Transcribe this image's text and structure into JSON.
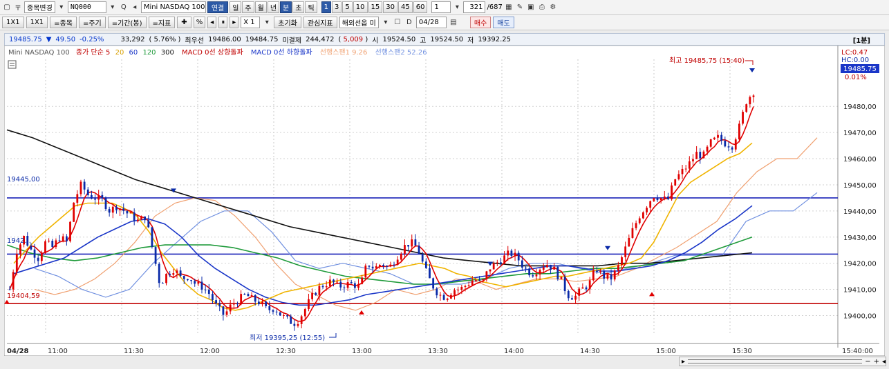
{
  "toolbar": {
    "stock_change_label": "종목변경",
    "code": "NQ000",
    "search_hint": "Q",
    "name": "Mini NASDAQ 100",
    "linked_label": "연결",
    "periods": [
      "일",
      "주",
      "월",
      "년",
      "분",
      "초",
      "틱"
    ],
    "period_selected": "분",
    "intervals": [
      "1",
      "3",
      "5",
      "10",
      "15",
      "30",
      "45",
      "60"
    ],
    "interval_selected": "1",
    "count_value": "1",
    "pages": "321",
    "pages_total": "/687"
  },
  "toolbar2": {
    "ratio1": "1X1",
    "ratio2": "1X1",
    "item_label": "=종목",
    "cycle_label": "=주기",
    "period_label": "=기간(봉)",
    "indicator_label": "=지표",
    "zoom": "X 1",
    "reset_label": "초기화",
    "interest_label": "관심지표",
    "overseas_label": "해외선옵 미",
    "date_value": "04/28",
    "buy_label": "매수",
    "sell_label": "매도"
  },
  "quote": {
    "price": "19485.75",
    "arrow": "▼",
    "change": "49.50",
    "change_pct": "-0.25%",
    "volume": "33,292",
    "volume_pct": "5.76%",
    "best_bid_label": "최우선",
    "bid": "19486.00",
    "ask": "19484.75",
    "unsettled_label": "미결제",
    "open_interest": "244,472",
    "oi_change": "5,009",
    "open_label": "시",
    "open": "19524.50",
    "high_label": "고",
    "high": "19524.50",
    "low_label": "저",
    "low": "19392.25",
    "period_badge": "[1분]"
  },
  "legend": {
    "name": "Mini NASDAQ 100",
    "ma_label": "종가 단순 5",
    "ma_20": "20",
    "ma_60": "60",
    "ma_120": "120",
    "ma_300": "300",
    "macd_up": "MACD 0선 상향돌파",
    "macd_down": "MACD 0선 하향돌파",
    "span1": "선행스팬1 9.26",
    "span2": "선행스팬2 52.26"
  },
  "colors": {
    "up": "#e00000",
    "down": "#0a2aa8",
    "ma5": "#e00000",
    "ma20": "#f0b400",
    "ma60": "#1a36c8",
    "ma120": "#1e9a3a",
    "ma300": "#111111",
    "span1": "#f0a070",
    "span2": "#7090e0",
    "hline_blue": "#1a22b8",
    "hline_red": "#c00000"
  },
  "chart_data": {
    "type": "candlestick",
    "ylim": [
      19393,
      19498
    ],
    "y_ticks": [
      "19400,00",
      "19410,00",
      "19420,00",
      "19430,00",
      "19440,00",
      "19450,00",
      "19460,00",
      "19470,00",
      "19480,00"
    ],
    "x_ticks": [
      "04/28",
      "11:00",
      "11:30",
      "12:00",
      "12:30",
      "13:00",
      "13:30",
      "14:00",
      "14:30",
      "15:00",
      "15:30",
      "15:40:00"
    ],
    "axis_right_labels": {
      "lc": "LC:0.47",
      "hc": "HC:0.00",
      "last": "19485.75",
      "pct": "0.01%"
    },
    "annotations": {
      "high_text": "최고 19485,75 (15:40)",
      "low_text": "최저 19395,25 (12:55)",
      "level_high": "19445,00",
      "level_low": "19404,59",
      "level_mid_label": "1942..."
    },
    "levels": {
      "high": 19445.0,
      "low": 19404.59,
      "mid": 19423.5
    },
    "price_path": [
      19410,
      19425,
      19430,
      19425,
      19422,
      19428,
      19426,
      19430,
      19428,
      19444,
      19450,
      19446,
      19445,
      19444,
      19440,
      19442,
      19440,
      19438,
      19436,
      19438,
      19425,
      19412,
      19416,
      19418,
      19414,
      19415,
      19412,
      19411,
      19408,
      19403,
      19400,
      19404,
      19406,
      19408,
      19406,
      19405,
      19402,
      19403,
      19400,
      19398,
      19397,
      19401,
      19406,
      19410,
      19412,
      19413,
      19411,
      19412,
      19412,
      19411,
      19420,
      19418,
      19420,
      19418,
      19422,
      19426,
      19428,
      19426,
      19418,
      19412,
      19408,
      19407,
      19410,
      19410,
      19412,
      19414,
      19412,
      19418,
      19420,
      19422,
      19424,
      19422,
      19418,
      19416,
      19418,
      19420,
      19418,
      19414,
      19408,
      19407,
      19410,
      19412,
      19418,
      19415,
      19414,
      19418,
      19425,
      19432,
      19438,
      19442,
      19446,
      19445,
      19444,
      19452,
      19455,
      19458,
      19462,
      19461,
      19466,
      19468,
      19466,
      19465,
      19472,
      19482,
      19485.75
    ],
    "ma20_path": [
      19420,
      19425,
      19430,
      19434,
      19438,
      19442,
      19443,
      19443,
      19443,
      19441,
      19438,
      19432,
      19424,
      19418,
      19412,
      19408,
      19406,
      19403,
      19402,
      19403,
      19405,
      19407,
      19409,
      19410,
      19411,
      19412,
      19413,
      19414,
      19415,
      19416,
      19417,
      19418,
      19419,
      19420,
      19419,
      19418,
      19416,
      19415,
      19413,
      19412,
      19411,
      19412,
      19413,
      19414,
      19415,
      19415,
      19416,
      19417,
      19418,
      19419,
      19420,
      19422,
      19428,
      19437,
      19446,
      19451,
      19454,
      19457,
      19460,
      19462,
      19466
    ],
    "ma60_path": [
      19416,
      19418,
      19420,
      19422,
      19426,
      19430,
      19433,
      19436,
      19437,
      19435,
      19430,
      19423,
      19418,
      19414,
      19410,
      19407,
      19405,
      19404,
      19404,
      19405,
      19406,
      19408,
      19409,
      19410,
      19411,
      19412,
      19413,
      19414,
      19415,
      19416,
      19417,
      19418,
      19419,
      19419,
      19418,
      19417,
      19417,
      19418,
      19419,
      19421,
      19424,
      19428,
      19433,
      19437,
      19442
    ],
    "ma120_path": [
      19427,
      19424,
      19422,
      19421,
      19422,
      19424,
      19426,
      19427,
      19427,
      19427,
      19426,
      19424,
      19422,
      19419,
      19417,
      19415,
      19414,
      19413,
      19412,
      19412,
      19413,
      19414,
      19415,
      19416,
      19416,
      19417,
      19418,
      19418,
      19419,
      19420,
      19421,
      19424,
      19427,
      19430
    ],
    "ma300_path": [
      19471,
      19468,
      19464,
      19460,
      19456,
      19452,
      19449,
      19446,
      19443,
      19440,
      19437,
      19434,
      19432,
      19430,
      19428,
      19426,
      19424,
      19422,
      19421,
      19420,
      19419,
      19419,
      19419,
      19419,
      19420,
      19420,
      19421,
      19422,
      19423,
      19424
    ],
    "span1_path": [
      19410,
      19408,
      19410,
      19414,
      19420,
      19428,
      19438,
      19443,
      19445,
      19444,
      19438,
      19430,
      19420,
      19412,
      19408,
      19404,
      19402,
      19405,
      19410,
      19408,
      19410,
      19414,
      19413,
      19410,
      19412,
      19414,
      19414,
      19413,
      19414,
      19415,
      19418,
      19422,
      19426,
      19431,
      19436,
      19447,
      19455,
      19460,
      19460,
      19468
    ],
    "span2_path": [
      19418,
      19415,
      19410,
      19407,
      19410,
      19420,
      19428,
      19436,
      19440,
      19440,
      19432,
      19421,
      19418,
      19420,
      19418,
      19416,
      19412,
      19412,
      19412,
      19414,
      19418,
      19420,
      19420,
      19418,
      19416,
      19418,
      19420,
      19423,
      19423,
      19423,
      19436,
      19440,
      19440,
      19447
    ]
  },
  "scroll": {
    "label": "▸"
  }
}
